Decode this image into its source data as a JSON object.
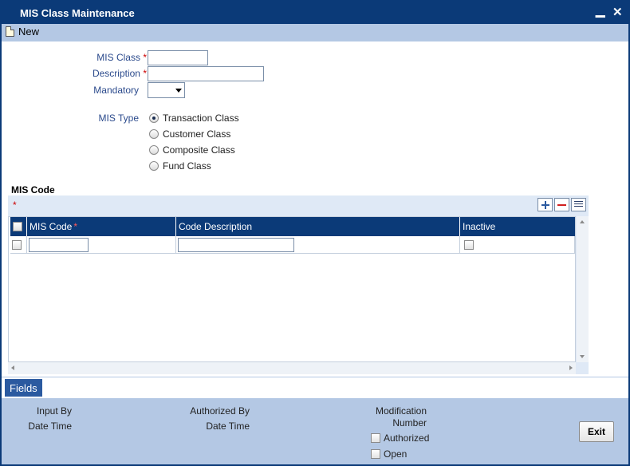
{
  "window": {
    "title": "MIS Class Maintenance",
    "minimize_glyph": "▁",
    "close_glyph": "✕"
  },
  "toolbar": {
    "new_label": "New",
    "new_icon": "document-icon"
  },
  "form": {
    "mis_class_label": "MIS Class",
    "description_label": "Description",
    "mandatory_label": "Mandatory",
    "required_marker": "*",
    "mis_class_value": "",
    "description_value": "",
    "mandatory_value": "",
    "mis_type_label": "MIS Type",
    "mis_type_options": [
      {
        "label": "Transaction Class",
        "checked": true
      },
      {
        "label": "Customer Class",
        "checked": false
      },
      {
        "label": "Composite Class",
        "checked": false
      },
      {
        "label": "Fund Class",
        "checked": false
      }
    ]
  },
  "mis_code_section": {
    "title": "MIS Code",
    "required_marker": "*",
    "columns": [
      {
        "label": "MIS Code",
        "required": "*"
      },
      {
        "label": "Code Description",
        "required": ""
      },
      {
        "label": "Inactive",
        "required": ""
      }
    ],
    "rows": [
      {
        "mis_code": "",
        "code_description": "",
        "inactive": false
      }
    ]
  },
  "fields_tab": {
    "label": "Fields"
  },
  "footer": {
    "input_by": "Input By",
    "date_time_1": "Date Time",
    "authorized_by": "Authorized By",
    "date_time_2": "Date Time",
    "modification": "Modification",
    "number": "Number",
    "authorized": "Authorized",
    "open": "Open",
    "exit": "Exit"
  },
  "colors": {
    "titlebar": "#0b3a78",
    "toolbar": "#b4c8e4",
    "label": "#2b4a8c",
    "required": "#cc0000"
  }
}
